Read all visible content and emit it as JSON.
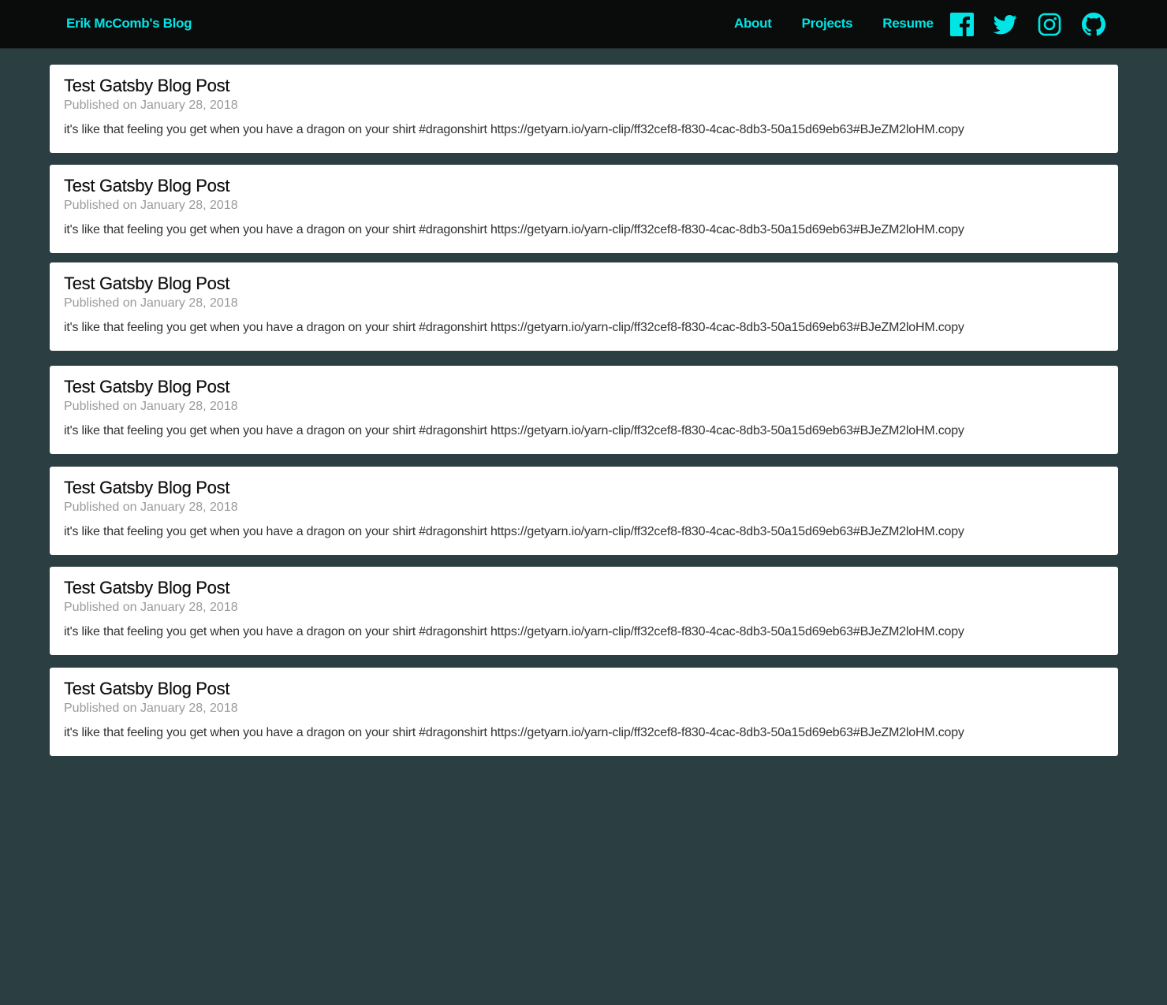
{
  "header": {
    "brand": "Erik McComb's Blog",
    "nav": [
      {
        "label": "About"
      },
      {
        "label": "Projects"
      },
      {
        "label": "Resume"
      }
    ],
    "social": [
      "facebook-icon",
      "twitter-icon",
      "instagram-icon",
      "github-icon"
    ],
    "accent_color": "#00e5e5"
  },
  "posts": [
    {
      "title": "Test Gatsby Blog Post",
      "date": "Published on January 28, 2018",
      "excerpt": "it's like that feeling you get when you have a dragon on your shirt #dragonshirt https://getyarn.io/yarn-clip/ff32cef8-f830-4cac-8db3-50a15d69eb63#BJeZM2loHM.copy"
    },
    {
      "title": "Test Gatsby Blog Post",
      "date": "Published on January 28, 2018",
      "excerpt": "it's like that feeling you get when you have a dragon on your shirt #dragonshirt https://getyarn.io/yarn-clip/ff32cef8-f830-4cac-8db3-50a15d69eb63#BJeZM2loHM.copy"
    },
    {
      "title": "Test Gatsby Blog Post",
      "date": "Published on January 28, 2018",
      "excerpt": "it's like that feeling you get when you have a dragon on your shirt #dragonshirt https://getyarn.io/yarn-clip/ff32cef8-f830-4cac-8db3-50a15d69eb63#BJeZM2loHM.copy"
    },
    {
      "title": "Test Gatsby Blog Post",
      "date": "Published on January 28, 2018",
      "excerpt": "it's like that feeling you get when you have a dragon on your shirt #dragonshirt https://getyarn.io/yarn-clip/ff32cef8-f830-4cac-8db3-50a15d69eb63#BJeZM2loHM.copy"
    },
    {
      "title": "Test Gatsby Blog Post",
      "date": "Published on January 28, 2018",
      "excerpt": "it's like that feeling you get when you have a dragon on your shirt #dragonshirt https://getyarn.io/yarn-clip/ff32cef8-f830-4cac-8db3-50a15d69eb63#BJeZM2loHM.copy"
    },
    {
      "title": "Test Gatsby Blog Post",
      "date": "Published on January 28, 2018",
      "excerpt": "it's like that feeling you get when you have a dragon on your shirt #dragonshirt https://getyarn.io/yarn-clip/ff32cef8-f830-4cac-8db3-50a15d69eb63#BJeZM2loHM.copy"
    },
    {
      "title": "Test Gatsby Blog Post",
      "date": "Published on January 28, 2018",
      "excerpt": "it's like that feeling you get when you have a dragon on your shirt #dragonshirt https://getyarn.io/yarn-clip/ff32cef8-f830-4cac-8db3-50a15d69eb63#BJeZM2loHM.copy"
    }
  ]
}
